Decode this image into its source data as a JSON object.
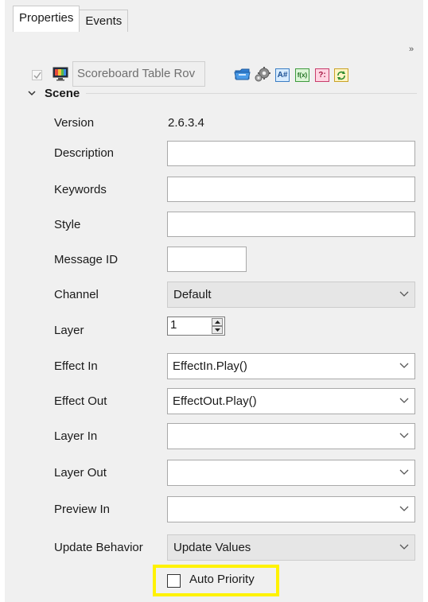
{
  "tabs": [
    {
      "label": "Properties",
      "active": true
    },
    {
      "label": "Events",
      "active": false
    }
  ],
  "toolbar": {
    "enabled_checked": true,
    "scene_name": "Scoreboard Table Rov",
    "icons": [
      "monitor-icon",
      "folder-icon",
      "gears-icon",
      "string-format-icon",
      "function-icon",
      "question-icon",
      "refresh-icon"
    ],
    "string_icon_text": "A#",
    "function_icon_text": "f(x)",
    "question_icon_text": "?:",
    "more": "»"
  },
  "section": {
    "title": "Scene",
    "expanded": true
  },
  "fields": {
    "version": {
      "label": "Version",
      "value": "2.6.3.4"
    },
    "description": {
      "label": "Description",
      "value": ""
    },
    "keywords": {
      "label": "Keywords",
      "value": ""
    },
    "style": {
      "label": "Style",
      "value": ""
    },
    "message_id": {
      "label": "Message ID",
      "value": ""
    },
    "channel": {
      "label": "Channel",
      "value": "Default"
    },
    "layer": {
      "label": "Layer",
      "value": "1"
    },
    "effect_in": {
      "label": "Effect In",
      "value": "EffectIn.Play()"
    },
    "effect_out": {
      "label": "Effect Out",
      "value": "EffectOut.Play()"
    },
    "layer_in": {
      "label": "Layer In",
      "value": ""
    },
    "layer_out": {
      "label": "Layer Out",
      "value": ""
    },
    "preview_in": {
      "label": "Preview In",
      "value": ""
    },
    "update_behavior": {
      "label": "Update Behavior",
      "value": "Update Values"
    },
    "auto_priority": {
      "label": "Auto Priority",
      "checked": false
    }
  },
  "colors": {
    "highlight": "#fff200",
    "panel_bg": "#f0f0f0",
    "flat_combo_bg": "#e6e6e6"
  }
}
